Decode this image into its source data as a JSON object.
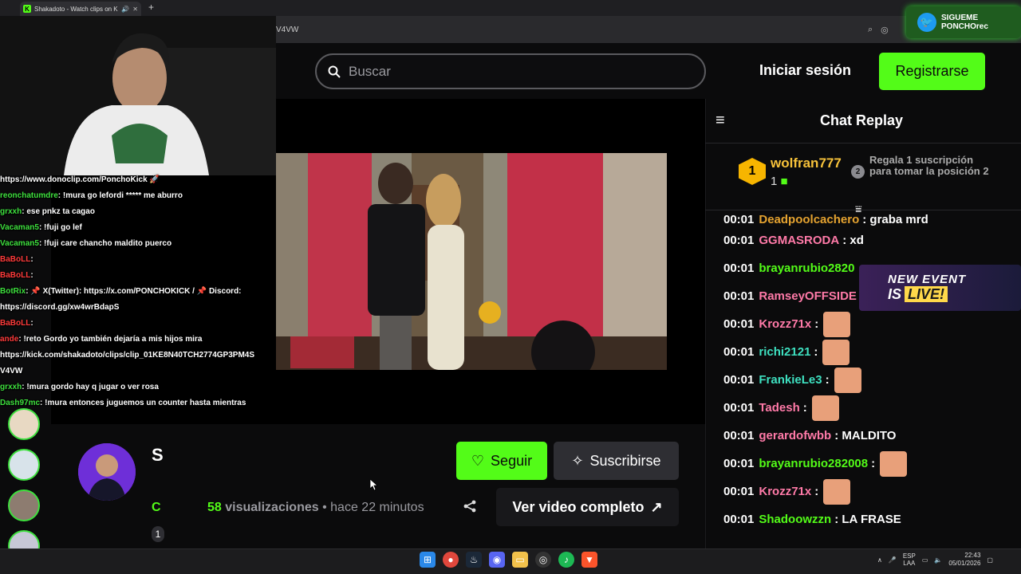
{
  "browser": {
    "tab_title": "Shakadoto - Watch clips on Kick",
    "url_fragment": "V4VW"
  },
  "twitter_badge": {
    "line1": "SIGUEME",
    "line2": "PONCHOrec"
  },
  "header": {
    "search_placeholder": "Buscar",
    "login_label": "Iniciar sesión",
    "register_label": "Registrarse"
  },
  "overlay_chat": [
    {
      "user": "",
      "msg": "https://www.donoclip.com/PonchoKick 🚀",
      "red": false
    },
    {
      "user": "reonchatumdre",
      "msg": ": !mura go lefordi ***** me aburro",
      "red": false
    },
    {
      "user": "grxxh",
      "msg": ": ese pnkz ta cagao",
      "red": false
    },
    {
      "user": "Vacaman5",
      "msg": ": !fuji go lef",
      "red": false
    },
    {
      "user": "Vacaman5",
      "msg": ": !fuji care chancho maldito puerco",
      "red": false
    },
    {
      "user": "BaBoLL",
      "msg": ":",
      "red": true
    },
    {
      "user": "BaBoLL",
      "msg": ":",
      "red": true
    },
    {
      "user": "BotRix",
      "msg": ": 📌 X(Twitter): https://x.com/PONCHOKICK / 📌 Discord:",
      "red": false
    },
    {
      "user": "",
      "msg": "https://discord.gg/xw4wrBdapS",
      "red": false
    },
    {
      "user": "BaBoLL",
      "msg": ":",
      "red": true
    },
    {
      "user": "ande",
      "msg": ": !reto Gordo yo también dejaría a mis hijos mira",
      "red": true
    },
    {
      "user": "",
      "msg": "https://kick.com/shakadoto/clips/clip_01KE8N40TCH2774GP3PM4S",
      "red": false
    },
    {
      "user": "",
      "msg": "V4VW",
      "red": false
    },
    {
      "user": "grxxh",
      "msg": ": !mura gordo hay q jugar o ver rosa",
      "red": false
    },
    {
      "user": "Dash97mc",
      "msg": ": !mura entonces juguemos un counter hasta mientras",
      "red": false
    }
  ],
  "channel": {
    "name_partial": "S",
    "follow_label": "Seguir",
    "subscribe_label": "Suscribirse",
    "views_count": "58",
    "views_label": "visualizaciones",
    "separator": "•",
    "time_ago": "hace 22 minutos",
    "full_video_label": "Ver video completo",
    "badge_partial": "1",
    "sub_partial": "C"
  },
  "chat": {
    "title": "Chat Replay",
    "leader": {
      "rank": "1",
      "name": "wolfran777",
      "count": "1",
      "rank2": "2",
      "gift_text": "Regala 1 suscripción para tomar la posición 2"
    },
    "messages": [
      {
        "time": "00:01",
        "user": "Deadpoolcachero",
        "color": "#e5a330",
        "msg": ": graba mrd",
        "emote": false
      },
      {
        "time": "00:01",
        "user": "GGMASRODA",
        "color": "#ff7aa8",
        "msg": ": xd",
        "emote": false
      },
      {
        "time": "00:01",
        "user": "brayanrubio2820",
        "color": "#53fc18",
        "msg": "",
        "emote": false
      },
      {
        "time": "00:01",
        "user": "RamseyOFFSIDE",
        "color": "#ff7aa8",
        "msg": ":",
        "emote": false
      },
      {
        "time": "00:01",
        "user": "Krozz71x",
        "color": "#ff7aa8",
        "msg": ":",
        "emote": true
      },
      {
        "time": "00:01",
        "user": "richi2121",
        "color": "#3ee0c0",
        "msg": ":",
        "emote": true
      },
      {
        "time": "00:01",
        "user": "FrankieLe3",
        "color": "#3ee0c0",
        "msg": ":",
        "emote": true
      },
      {
        "time": "00:01",
        "user": "Tadesh",
        "color": "#ff7aa8",
        "msg": ":",
        "emote": true
      },
      {
        "time": "00:01",
        "user": "gerardofwbb",
        "color": "#ff7aa8",
        "msg": ": MALDITO",
        "emote": false
      },
      {
        "time": "00:01",
        "user": "brayanrubio282008",
        "color": "#53fc18",
        "msg": ":",
        "emote": true
      },
      {
        "time": "00:01",
        "user": "Krozz71x",
        "color": "#ff7aa8",
        "msg": ":",
        "emote": true
      },
      {
        "time": "00:01",
        "user": "Shadoowzzn",
        "color": "#53fc18",
        "msg": ": LA FRASE",
        "emote": false
      }
    ]
  },
  "event_banner": {
    "line1": "NEW EVENT",
    "line2_prefix": "IS",
    "line2_highlight": "LIVE!"
  },
  "taskbar": {
    "lang1": "ESP",
    "lang2": "LAA",
    "time": "22:43",
    "date": "05/01/2026"
  }
}
